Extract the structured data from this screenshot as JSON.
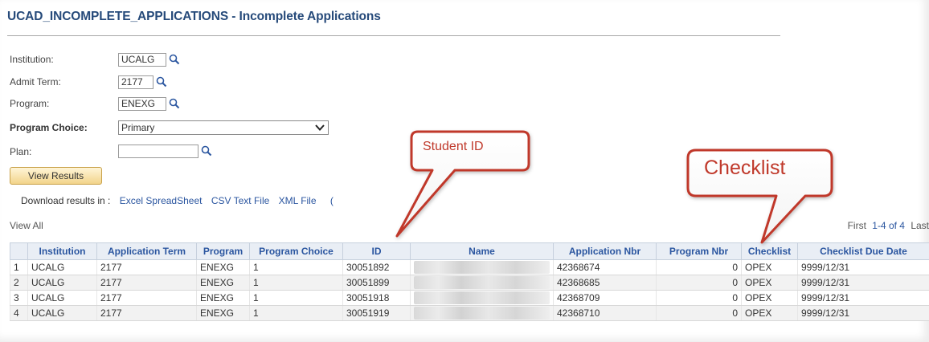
{
  "page": {
    "title": "UCAD_INCOMPLETE_APPLICATIONS - Incomplete Applications"
  },
  "form": {
    "institution": {
      "label": "Institution:",
      "value": "UCALG"
    },
    "admit_term": {
      "label": "Admit Term:",
      "value": "2177"
    },
    "program": {
      "label": "Program:",
      "value": "ENEXG"
    },
    "program_choice": {
      "label": "Program Choice:",
      "value": "Primary"
    },
    "plan": {
      "label": "Plan:",
      "value": ""
    }
  },
  "buttons": {
    "view_results": "View Results"
  },
  "download": {
    "prefix": "Download results in :",
    "excel": "Excel SpreadSheet",
    "csv": "CSV Text File",
    "xml": "XML File",
    "paren": "("
  },
  "grid": {
    "view_all": "View All",
    "nav_first": "First",
    "nav_range": "1-4 of 4",
    "nav_last": "Last",
    "columns": [
      "Institution",
      "Application Term",
      "Program",
      "Program Choice",
      "ID",
      "Name",
      "Application Nbr",
      "Program Nbr",
      "Checklist",
      "Checklist Due Date"
    ],
    "rows": [
      {
        "num": "1",
        "institution": "UCALG",
        "term": "2177",
        "program": "ENEXG",
        "choice": "1",
        "id": "30051892",
        "name": "",
        "app_nbr": "42368674",
        "prog_nbr": "0",
        "checklist": "OPEX",
        "due": "9999/12/31"
      },
      {
        "num": "2",
        "institution": "UCALG",
        "term": "2177",
        "program": "ENEXG",
        "choice": "1",
        "id": "30051899",
        "name": "",
        "app_nbr": "42368685",
        "prog_nbr": "0",
        "checklist": "OPEX",
        "due": "9999/12/31"
      },
      {
        "num": "3",
        "institution": "UCALG",
        "term": "2177",
        "program": "ENEXG",
        "choice": "1",
        "id": "30051918",
        "name": "",
        "app_nbr": "42368709",
        "prog_nbr": "0",
        "checklist": "OPEX",
        "due": "9999/12/31"
      },
      {
        "num": "4",
        "institution": "UCALG",
        "term": "2177",
        "program": "ENEXG",
        "choice": "1",
        "id": "30051919",
        "name": "",
        "app_nbr": "42368710",
        "prog_nbr": "0",
        "checklist": "OPEX",
        "due": "9999/12/31"
      }
    ]
  },
  "callouts": {
    "student_id": "Student ID",
    "checklist": "Checklist"
  },
  "colors": {
    "title": "#264a7a",
    "link": "#2b56a0",
    "callout_border": "#c0392b",
    "header_bg": "#e9eef5",
    "button_bg": "#f2d48a"
  },
  "icons": {
    "lookup": "magnifier-icon",
    "dropdown": "chevron-down-icon"
  }
}
